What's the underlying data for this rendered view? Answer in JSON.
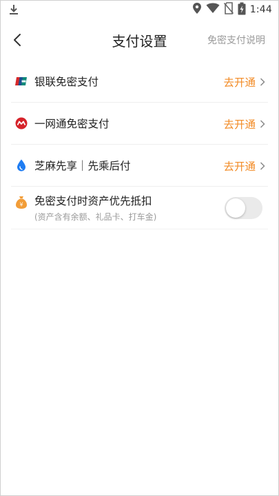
{
  "status_bar": {
    "time": "1:44",
    "icons": [
      "download-icon",
      "location-icon",
      "wifi-icon",
      "no-sim-icon",
      "battery-icon"
    ]
  },
  "header": {
    "title": "支付设置",
    "right_link": "免密支付说明",
    "back_icon": "chevron-left-icon"
  },
  "settings": {
    "items": [
      {
        "label": "银联免密支付",
        "action": "去开通",
        "icon": "unionpay-icon"
      },
      {
        "label": "一网通免密支付",
        "action": "去开通",
        "icon": "cmb-icon"
      },
      {
        "label": "芝麻先享｜先乘后付",
        "action": "去开通",
        "icon": "sesame-drop-icon"
      }
    ],
    "asset_priority": {
      "label": "免密支付时资产优先抵扣",
      "sublabel": "(资产含有余额、礼品卡、打车金)",
      "icon": "money-bag-icon",
      "enabled": false
    }
  },
  "colors": {
    "accent": "#f28b26",
    "unionpay_red": "#d7292a",
    "unionpay_blue": "#1d4f91",
    "unionpay_green": "#0e8a7a",
    "cmb_red": "#d6232a",
    "sesame_blue": "#1e7cf2",
    "money_orange": "#f29d38"
  }
}
